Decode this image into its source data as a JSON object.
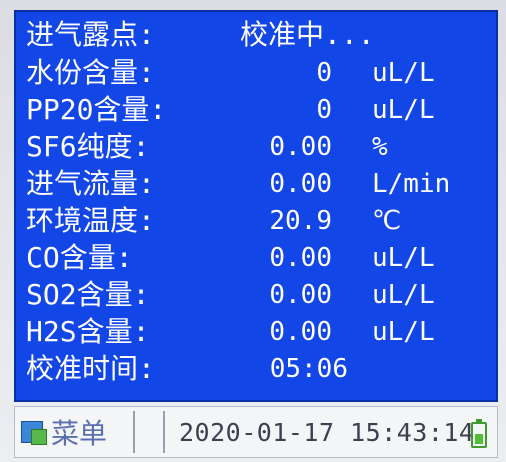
{
  "readings": [
    {
      "label": "进气露点:",
      "value": "校准中...",
      "unit": ""
    },
    {
      "label": "水份含量:",
      "value": "0",
      "unit": "uL/L"
    },
    {
      "label": "PP20含量:",
      "value": "0",
      "unit": "uL/L"
    },
    {
      "label": "SF6纯度:",
      "value": "0.00",
      "unit": "%"
    },
    {
      "label": "进气流量:",
      "value": "0.00",
      "unit": "L/min"
    },
    {
      "label": "环境温度:",
      "value": "20.9",
      "unit": "℃"
    },
    {
      "label": "CO含量:",
      "value": "0.00",
      "unit": "uL/L"
    },
    {
      "label": "SO2含量:",
      "value": "0.00",
      "unit": "uL/L"
    },
    {
      "label": "H2S含量:",
      "value": "0.00",
      "unit": "uL/L"
    },
    {
      "label": "校准时间:",
      "value": "05:06",
      "unit": ""
    }
  ],
  "statusbar": {
    "menu_label": "菜单",
    "menu_icon": "menu-icon",
    "datetime": "2020-01-17 15:43:14",
    "battery_icon": "battery-icon"
  },
  "colors": {
    "screen_bg": "#1246e6",
    "text": "#ffffff",
    "battery": "#4fbf33"
  }
}
